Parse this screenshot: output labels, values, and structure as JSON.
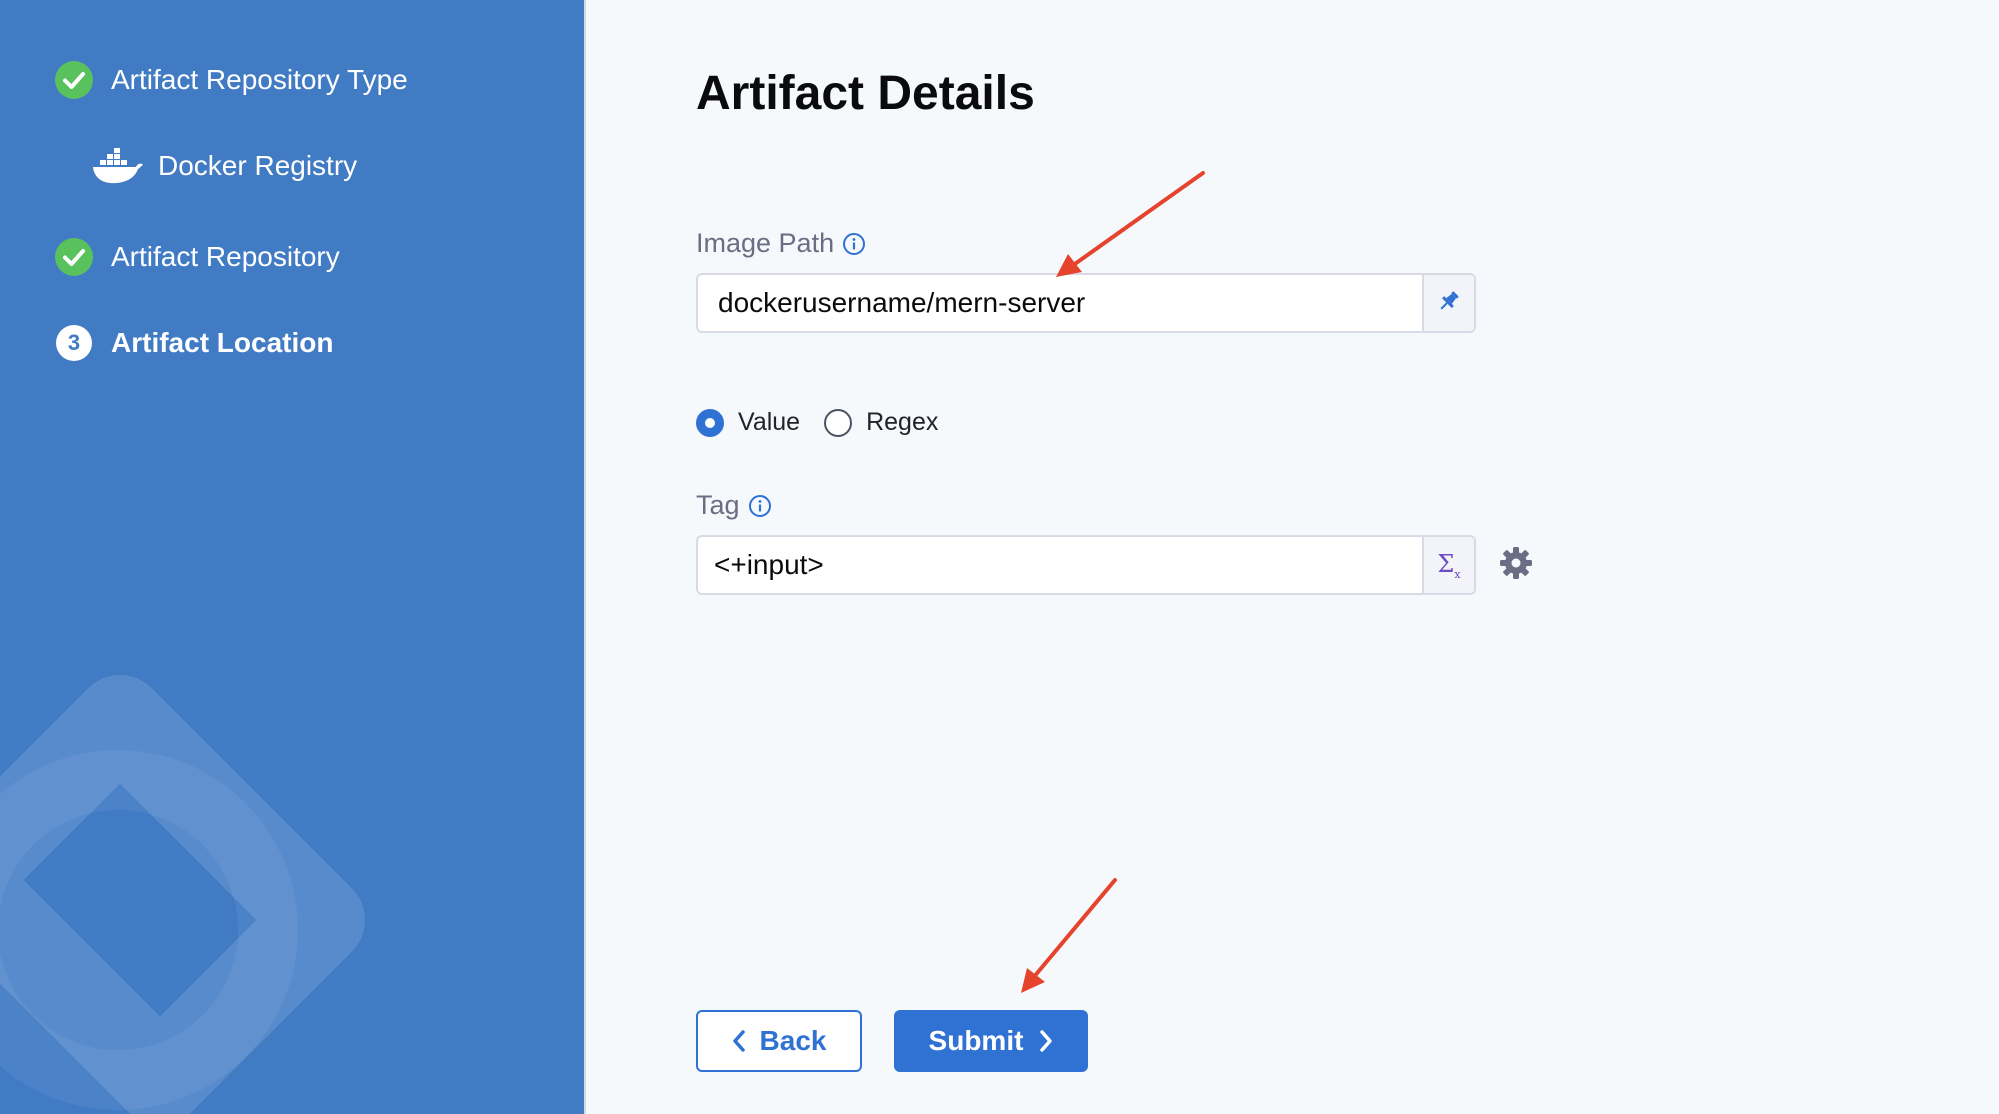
{
  "sidebar": {
    "steps": [
      {
        "label": "Artifact Repository Type",
        "state": "completed"
      },
      {
        "label": "Docker Registry",
        "state": "sub-item"
      },
      {
        "label": "Artifact Repository",
        "state": "completed"
      },
      {
        "label": "Artifact Location",
        "state": "active",
        "number": "3"
      }
    ]
  },
  "main": {
    "title": "Artifact Details",
    "image_path": {
      "label": "Image Path",
      "value": "dockerusername/mern-server"
    },
    "tag_type": {
      "options": [
        "Value",
        "Regex"
      ],
      "selected": "Value"
    },
    "tag": {
      "label": "Tag",
      "value": "<+input>",
      "addon": "Σ"
    },
    "buttons": {
      "back": "Back",
      "submit": "Submit"
    }
  },
  "colors": {
    "sidebar_bg": "#417bc4",
    "primary": "#2f72d4",
    "success": "#5ac25d",
    "annotation_arrow": "#e5432c"
  },
  "icons": [
    "check-circle-icon",
    "docker-icon",
    "info-icon",
    "pin-icon",
    "sigma-icon",
    "gear-icon",
    "chevron-left-icon",
    "chevron-right-icon"
  ]
}
